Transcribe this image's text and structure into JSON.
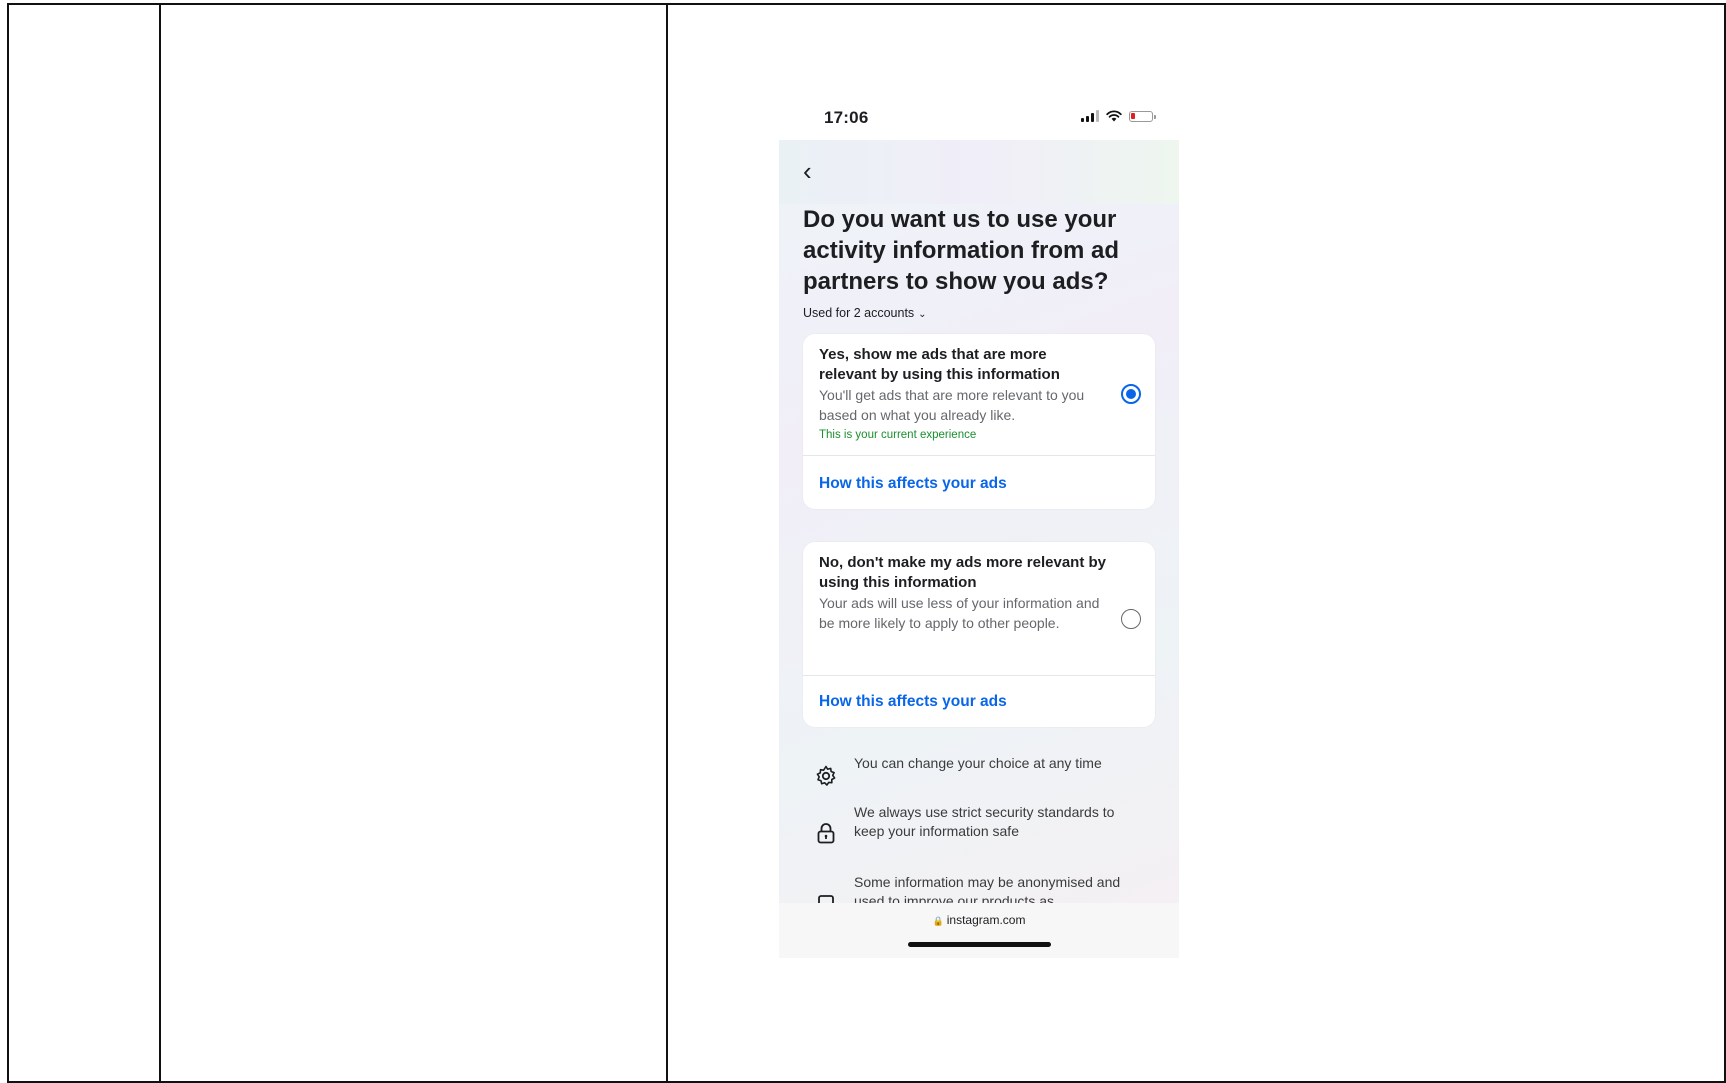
{
  "status_bar": {
    "time": "17:06"
  },
  "page": {
    "title": "Do you want us to use your activity information from ad partners to show you ads?",
    "used_for": "Used for 2 accounts"
  },
  "options": [
    {
      "title": "Yes, show me ads that are more relevant by using this information",
      "description": "You'll get ads that are more relevant to you based on what you already like.",
      "note": "This is your current experience",
      "link": "How this affects your ads",
      "selected": true
    },
    {
      "title": "No, don't make my ads more relevant by using this information",
      "description": "Your ads will use less of your information and be more likely to apply to other people.",
      "link": "How this affects your ads",
      "selected": false
    }
  ],
  "info": [
    {
      "icon": "gear-icon",
      "text": "You can change your choice at any time"
    },
    {
      "icon": "lock-icon",
      "text": "We always use strict security standards to keep your information safe"
    },
    {
      "icon": "device-icon",
      "text": "Some information may be anonymised and used to improve our products as"
    }
  ],
  "browser": {
    "url": "instagram.com"
  },
  "colors": {
    "accent": "#0a66e8",
    "current_note": "#1a8f2e"
  }
}
